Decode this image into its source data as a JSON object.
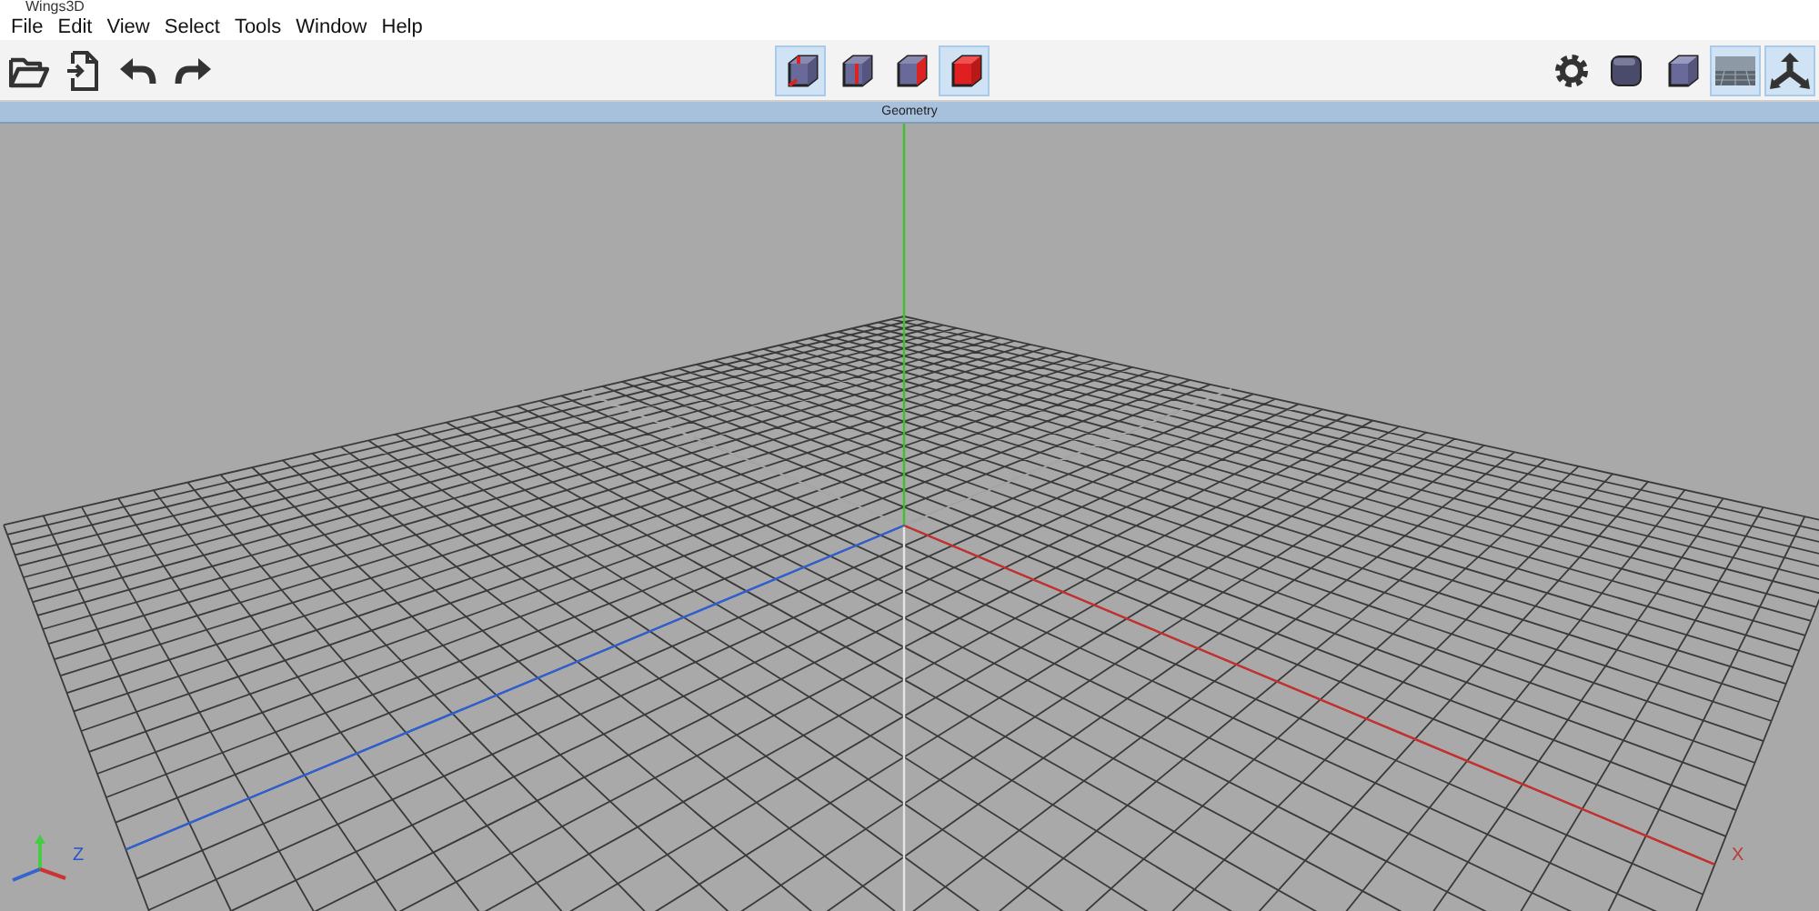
{
  "window": {
    "title": "Wings3D"
  },
  "menu": [
    "File",
    "Edit",
    "View",
    "Select",
    "Tools",
    "Window",
    "Help"
  ],
  "selection_modes": [
    {
      "kind": "vertex",
      "selected": true
    },
    {
      "kind": "edge",
      "selected": false
    },
    {
      "kind": "face",
      "selected": false
    },
    {
      "kind": "body",
      "selected": true
    }
  ],
  "view_toggles": [
    {
      "kind": "settings",
      "on": false
    },
    {
      "kind": "smooth",
      "on": false
    },
    {
      "kind": "flat",
      "on": false
    },
    {
      "kind": "ground",
      "on": true
    },
    {
      "kind": "axes",
      "on": true
    }
  ],
  "viewport": {
    "title": "Geometry",
    "z_label": "Z",
    "x_label": "X"
  }
}
